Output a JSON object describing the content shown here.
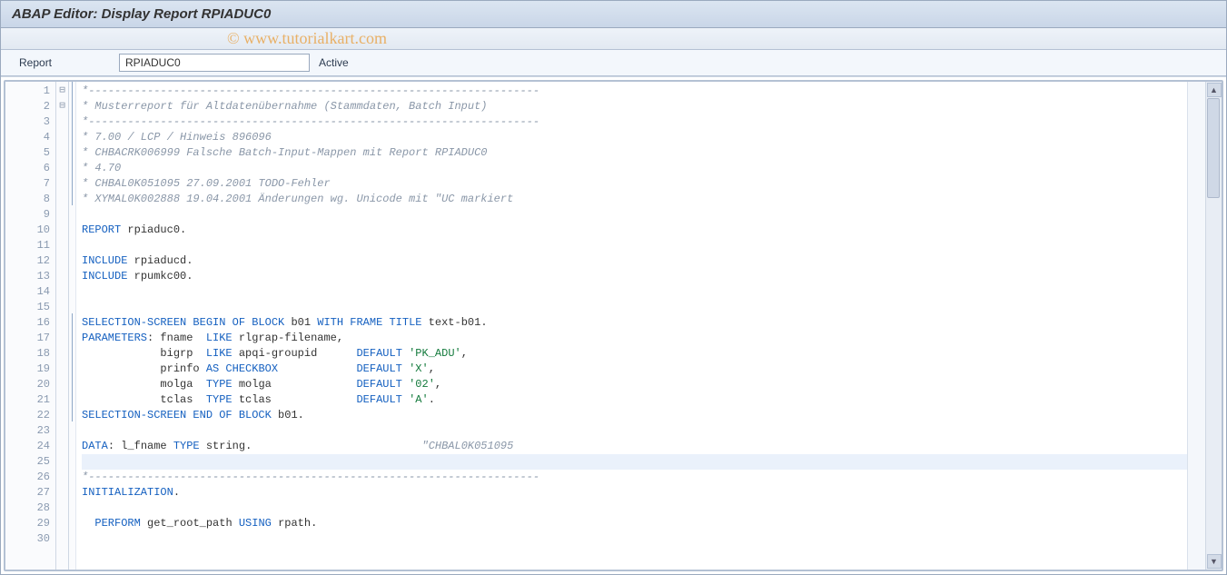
{
  "header": {
    "title": "ABAP Editor: Display Report RPIADUC0"
  },
  "watermark": "© www.tutorialkart.com",
  "reportBar": {
    "label": "Report",
    "value": "RPIADUC0",
    "status": "Active"
  },
  "fold": {
    "1": "⊟",
    "16": "⊟"
  },
  "structureBars": [
    1,
    2,
    3,
    4,
    5,
    6,
    7,
    8,
    16,
    17,
    18,
    19,
    20,
    21,
    22
  ],
  "highlightLine": 25,
  "code": [
    {
      "n": 1,
      "t": "comment",
      "text": "*---------------------------------------------------------------------"
    },
    {
      "n": 2,
      "t": "comment",
      "text": "* Musterreport für Altdatenübernahme (Stammdaten, Batch Input)"
    },
    {
      "n": 3,
      "t": "comment",
      "text": "*---------------------------------------------------------------------"
    },
    {
      "n": 4,
      "t": "comment",
      "text": "* 7.00 / LCP / Hinweis 896096"
    },
    {
      "n": 5,
      "t": "comment",
      "text": "* CHBACRK006999 Falsche Batch-Input-Mappen mit Report RPIADUC0"
    },
    {
      "n": 6,
      "t": "comment",
      "text": "* 4.70"
    },
    {
      "n": 7,
      "t": "comment",
      "text": "* CHBAL0K051095 27.09.2001 TODO-Fehler"
    },
    {
      "n": 8,
      "t": "comment",
      "text": "* XYMAL0K002888 19.04.2001 Änderungen wg. Unicode mit \"UC markiert"
    },
    {
      "n": 9,
      "t": "blank",
      "text": ""
    },
    {
      "n": 10,
      "t": "stmt",
      "tokens": [
        {
          "c": "kw",
          "v": "REPORT"
        },
        {
          "c": "nm",
          "v": " rpiaduc0"
        },
        {
          "c": "op",
          "v": "."
        }
      ]
    },
    {
      "n": 11,
      "t": "blank",
      "text": ""
    },
    {
      "n": 12,
      "t": "stmt",
      "tokens": [
        {
          "c": "kw",
          "v": "INCLUDE"
        },
        {
          "c": "nm",
          "v": " rpiaducd"
        },
        {
          "c": "op",
          "v": "."
        }
      ]
    },
    {
      "n": 13,
      "t": "stmt",
      "tokens": [
        {
          "c": "kw",
          "v": "INCLUDE"
        },
        {
          "c": "nm",
          "v": " rpumkc00"
        },
        {
          "c": "op",
          "v": "."
        }
      ]
    },
    {
      "n": 14,
      "t": "blank",
      "text": ""
    },
    {
      "n": 15,
      "t": "blank",
      "text": ""
    },
    {
      "n": 16,
      "t": "stmt",
      "tokens": [
        {
          "c": "kw",
          "v": "SELECTION-SCREEN BEGIN OF BLOCK"
        },
        {
          "c": "nm",
          "v": " b01 "
        },
        {
          "c": "kw",
          "v": "WITH FRAME TITLE"
        },
        {
          "c": "nm",
          "v": " text"
        },
        {
          "c": "op",
          "v": "-"
        },
        {
          "c": "nm",
          "v": "b01"
        },
        {
          "c": "op",
          "v": "."
        }
      ]
    },
    {
      "n": 17,
      "t": "stmt",
      "tokens": [
        {
          "c": "kw",
          "v": "PARAMETERS"
        },
        {
          "c": "op",
          "v": ":"
        },
        {
          "c": "nm",
          "v": " fname  "
        },
        {
          "c": "kw",
          "v": "LIKE"
        },
        {
          "c": "nm",
          "v": " rlgrap"
        },
        {
          "c": "op",
          "v": "-"
        },
        {
          "c": "nm",
          "v": "filename"
        },
        {
          "c": "op",
          "v": ","
        }
      ]
    },
    {
      "n": 18,
      "t": "stmt",
      "tokens": [
        {
          "c": "nm",
          "v": "            bigrp  "
        },
        {
          "c": "kw",
          "v": "LIKE"
        },
        {
          "c": "nm",
          "v": " apqi"
        },
        {
          "c": "op",
          "v": "-"
        },
        {
          "c": "nm",
          "v": "groupid      "
        },
        {
          "c": "kw",
          "v": "DEFAULT"
        },
        {
          "c": "nm",
          "v": " "
        },
        {
          "c": "str",
          "v": "'PK_ADU'"
        },
        {
          "c": "op",
          "v": ","
        }
      ]
    },
    {
      "n": 19,
      "t": "stmt",
      "tokens": [
        {
          "c": "nm",
          "v": "            prinfo "
        },
        {
          "c": "kw",
          "v": "AS CHECKBOX"
        },
        {
          "c": "nm",
          "v": "            "
        },
        {
          "c": "kw",
          "v": "DEFAULT"
        },
        {
          "c": "nm",
          "v": " "
        },
        {
          "c": "str",
          "v": "'X'"
        },
        {
          "c": "op",
          "v": ","
        }
      ]
    },
    {
      "n": 20,
      "t": "stmt",
      "tokens": [
        {
          "c": "nm",
          "v": "            molga  "
        },
        {
          "c": "kw",
          "v": "TYPE"
        },
        {
          "c": "nm",
          "v": " molga             "
        },
        {
          "c": "kw",
          "v": "DEFAULT"
        },
        {
          "c": "nm",
          "v": " "
        },
        {
          "c": "str",
          "v": "'02'"
        },
        {
          "c": "op",
          "v": ","
        }
      ]
    },
    {
      "n": 21,
      "t": "stmt",
      "tokens": [
        {
          "c": "nm",
          "v": "            tclas  "
        },
        {
          "c": "kw",
          "v": "TYPE"
        },
        {
          "c": "nm",
          "v": " tclas             "
        },
        {
          "c": "kw",
          "v": "DEFAULT"
        },
        {
          "c": "nm",
          "v": " "
        },
        {
          "c": "str",
          "v": "'A'"
        },
        {
          "c": "op",
          "v": "."
        }
      ]
    },
    {
      "n": 22,
      "t": "stmt",
      "tokens": [
        {
          "c": "kw",
          "v": "SELECTION-SCREEN END OF BLOCK"
        },
        {
          "c": "nm",
          "v": " b01"
        },
        {
          "c": "op",
          "v": "."
        }
      ]
    },
    {
      "n": 23,
      "t": "blank",
      "text": ""
    },
    {
      "n": 24,
      "t": "stmt",
      "tokens": [
        {
          "c": "kw",
          "v": "DATA"
        },
        {
          "c": "op",
          "v": ":"
        },
        {
          "c": "nm",
          "v": " l_fname "
        },
        {
          "c": "kw",
          "v": "TYPE"
        },
        {
          "c": "nm",
          "v": " string"
        },
        {
          "c": "op",
          "v": "."
        },
        {
          "c": "nm",
          "v": "                          "
        },
        {
          "c": "comment",
          "v": "\"CHBAL0K051095"
        }
      ]
    },
    {
      "n": 25,
      "t": "blank",
      "text": ""
    },
    {
      "n": 26,
      "t": "comment",
      "text": "*---------------------------------------------------------------------"
    },
    {
      "n": 27,
      "t": "stmt",
      "tokens": [
        {
          "c": "kw",
          "v": "INITIALIZATION"
        },
        {
          "c": "op",
          "v": "."
        }
      ]
    },
    {
      "n": 28,
      "t": "blank",
      "text": ""
    },
    {
      "n": 29,
      "t": "stmt",
      "tokens": [
        {
          "c": "nm",
          "v": "  "
        },
        {
          "c": "kw",
          "v": "PERFORM"
        },
        {
          "c": "nm",
          "v": " get_root_path "
        },
        {
          "c": "kw",
          "v": "USING"
        },
        {
          "c": "nm",
          "v": " rpath"
        },
        {
          "c": "op",
          "v": "."
        }
      ]
    },
    {
      "n": 30,
      "t": "blank",
      "text": ""
    }
  ]
}
